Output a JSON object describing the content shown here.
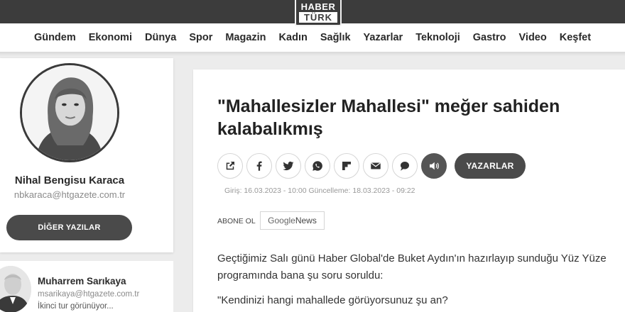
{
  "brand": {
    "logo_top": "HABER",
    "logo_bottom": "TÜRK"
  },
  "nav": [
    "Gündem",
    "Ekonomi",
    "Dünya",
    "Spor",
    "Magazin",
    "Kadın",
    "Sağlık",
    "Yazarlar",
    "Teknoloji",
    "Gastro",
    "Video",
    "Keşfet"
  ],
  "author": {
    "name": "Nihal Bengisu Karaca",
    "email": "nbkaraca@htgazete.com.tr",
    "other_button": "DİĞER YAZILAR"
  },
  "related_author": {
    "name": "Muharrem Sarıkaya",
    "email": "msarikaya@htgazete.com.tr",
    "teaser": "İkinci tur görünüyor..."
  },
  "article": {
    "title_line1": "\"Mahallesizler Mahallesi\" meğer sahiden",
    "title_line2": "kalabalıkmış",
    "share_icons": [
      "share-icon",
      "facebook-icon",
      "twitter-icon",
      "whatsapp-icon",
      "flipboard-icon",
      "mail-icon",
      "comment-icon",
      "audio-icon"
    ],
    "writers_button": "YAZARLAR",
    "dates": "Giriş: 16.03.2023 - 10:00 Güncelleme: 18.03.2023 - 09:22",
    "subscribe_label": "ABONE OL",
    "google_news_g": "Google",
    "google_news_label": " News",
    "paragraph1": "Geçtiğimiz Salı günü Haber Global'de Buket Aydın'ın hazırlayıp sunduğu Yüz Yüze programında bana şu soru soruldu:",
    "paragraph2": "\"Kendinizi hangi mahallede görüyorsunuz şu an?"
  }
}
